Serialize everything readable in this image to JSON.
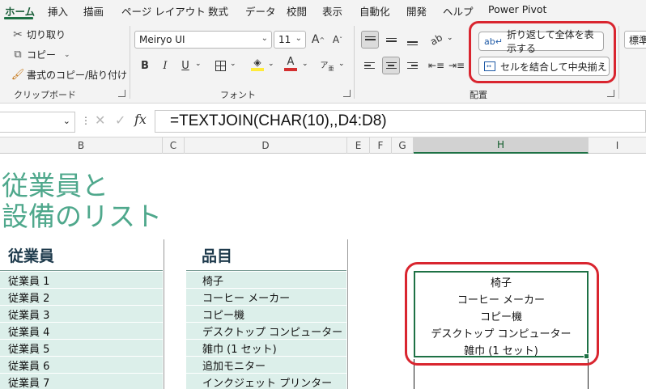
{
  "tabs": [
    "ホーム",
    "挿入",
    "描画",
    "ページ レイアウト",
    "数式",
    "データ",
    "校閲",
    "表示",
    "自動化",
    "開発",
    "ヘルプ",
    "Power Pivot"
  ],
  "ribbon": {
    "clipboard": {
      "cut": "切り取り",
      "copy": "コピー",
      "format_painter": "書式のコピー/貼り付け",
      "label": "クリップボード"
    },
    "font": {
      "name": "Meiryo UI",
      "size": "11",
      "grow": "A",
      "shrink": "A",
      "bold": "B",
      "italic": "I",
      "underline": "U",
      "label": "フォント",
      "accent_fill": "#ffeb3b",
      "accent_font": "#d32f2f"
    },
    "alignment": {
      "wrap": "折り返して全体を表示する",
      "merge": "セルを結合して中央揃え",
      "label": "配置"
    },
    "number": {
      "format": "標準"
    }
  },
  "formula_bar": {
    "fx": "fx",
    "formula": "=TEXTJOIN(CHAR(10),,D4:D8)"
  },
  "columns": [
    "B",
    "C",
    "D",
    "E",
    "F",
    "G",
    "H",
    "I"
  ],
  "sheet": {
    "title_line1": "従業員と",
    "title_line2": "設備のリスト",
    "header_b": "従業員",
    "header_d": "品目",
    "employees": [
      "従業員 1",
      "従業員 2",
      "従業員 3",
      "従業員 4",
      "従業員 5",
      "従業員 6",
      "従業員 7"
    ],
    "items": [
      "椅子",
      "コーヒー メーカー",
      "コピー機",
      "デスクトップ コンピューター",
      "雑巾 (1 セット)",
      "追加モニター",
      "インクジェット プリンター"
    ],
    "joined": [
      "椅子",
      "コーヒー メーカー",
      "コピー機",
      "デスクトップ コンピューター",
      "雑巾 (1 セット)"
    ]
  },
  "colors": {
    "accent": "#1e7145",
    "title": "#4fa88c",
    "band": "#dcefea",
    "highlight": "#d9252f"
  }
}
